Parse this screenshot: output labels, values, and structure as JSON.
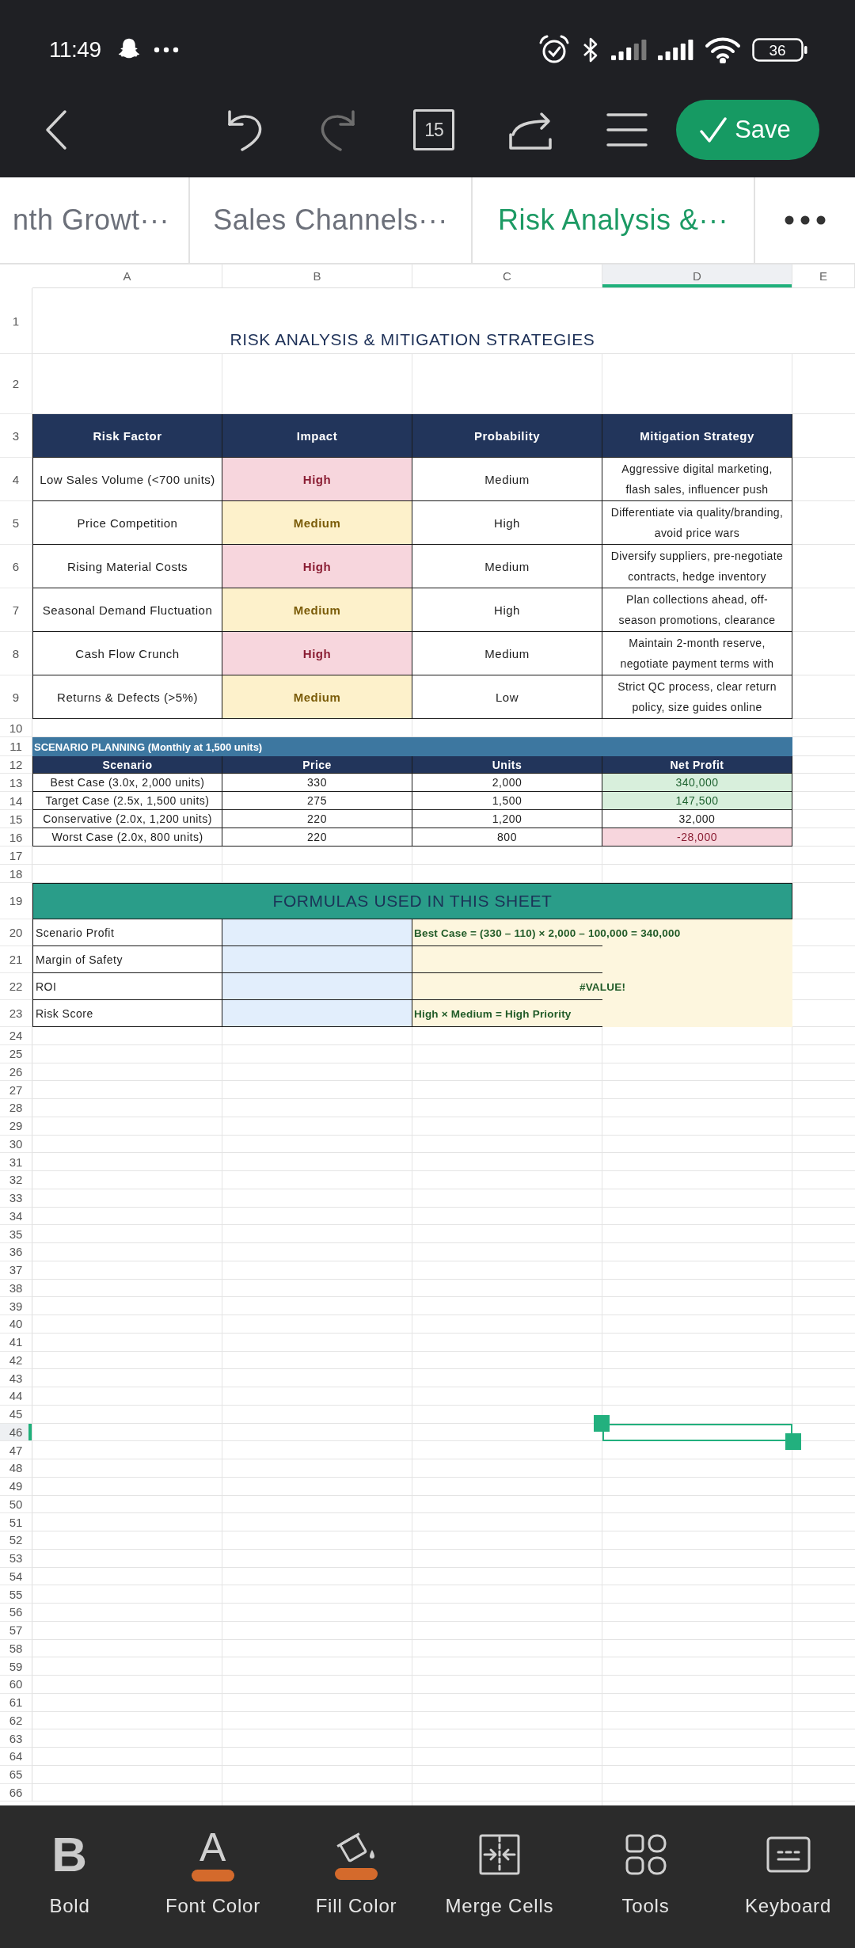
{
  "status_bar": {
    "time": "11:49",
    "battery": "36"
  },
  "toolbar": {
    "sheet_count": "15",
    "redo_disabled": true,
    "save_label": "Save"
  },
  "sheet_tabs": [
    {
      "label": "nth Growt···",
      "selected": false
    },
    {
      "label": "Sales Channels···",
      "selected": false
    },
    {
      "label": "Risk Analysis &···",
      "selected": true
    }
  ],
  "columns": [
    {
      "label": "A",
      "selected": false
    },
    {
      "label": "B",
      "selected": false
    },
    {
      "label": "C",
      "selected": false
    },
    {
      "label": "D",
      "selected": true
    },
    {
      "label": "E",
      "selected": false
    }
  ],
  "row_numbers": [
    {
      "label": "1",
      "selected": false
    },
    {
      "label": "2",
      "selected": false
    },
    {
      "label": "3",
      "selected": false
    },
    {
      "label": "4",
      "selected": false
    },
    {
      "label": "5",
      "selected": false
    },
    {
      "label": "6",
      "selected": false
    },
    {
      "label": "7",
      "selected": false
    },
    {
      "label": "8",
      "selected": false
    },
    {
      "label": "9",
      "selected": false
    },
    {
      "label": "10",
      "selected": false
    },
    {
      "label": "11",
      "selected": false
    },
    {
      "label": "12",
      "selected": false
    },
    {
      "label": "13",
      "selected": false
    },
    {
      "label": "14",
      "selected": false
    },
    {
      "label": "15",
      "selected": false
    },
    {
      "label": "16",
      "selected": false
    },
    {
      "label": "17",
      "selected": false
    },
    {
      "label": "18",
      "selected": false
    },
    {
      "label": "19",
      "selected": false
    },
    {
      "label": "20",
      "selected": false
    },
    {
      "label": "21",
      "selected": false
    },
    {
      "label": "22",
      "selected": false
    },
    {
      "label": "23",
      "selected": false
    },
    {
      "label": "24",
      "selected": false
    },
    {
      "label": "25",
      "selected": false
    },
    {
      "label": "26",
      "selected": false
    },
    {
      "label": "27",
      "selected": false
    },
    {
      "label": "28",
      "selected": false
    },
    {
      "label": "29",
      "selected": false
    },
    {
      "label": "30",
      "selected": false
    },
    {
      "label": "31",
      "selected": false
    },
    {
      "label": "32",
      "selected": false
    },
    {
      "label": "33",
      "selected": false
    },
    {
      "label": "34",
      "selected": false
    },
    {
      "label": "35",
      "selected": false
    },
    {
      "label": "36",
      "selected": false
    },
    {
      "label": "37",
      "selected": false
    },
    {
      "label": "38",
      "selected": false
    },
    {
      "label": "39",
      "selected": false
    },
    {
      "label": "40",
      "selected": false
    },
    {
      "label": "41",
      "selected": false
    },
    {
      "label": "42",
      "selected": false
    },
    {
      "label": "43",
      "selected": false
    },
    {
      "label": "44",
      "selected": false
    },
    {
      "label": "45",
      "selected": false
    },
    {
      "label": "46",
      "selected": true
    },
    {
      "label": "47",
      "selected": false
    },
    {
      "label": "48",
      "selected": false
    },
    {
      "label": "49",
      "selected": false
    },
    {
      "label": "50",
      "selected": false
    },
    {
      "label": "51",
      "selected": false
    },
    {
      "label": "52",
      "selected": false
    },
    {
      "label": "53",
      "selected": false
    },
    {
      "label": "54",
      "selected": false
    },
    {
      "label": "55",
      "selected": false
    },
    {
      "label": "56",
      "selected": false
    },
    {
      "label": "57",
      "selected": false
    },
    {
      "label": "58",
      "selected": false
    },
    {
      "label": "59",
      "selected": false
    },
    {
      "label": "60",
      "selected": false
    },
    {
      "label": "61",
      "selected": false
    },
    {
      "label": "62",
      "selected": false
    },
    {
      "label": "63",
      "selected": false
    },
    {
      "label": "64",
      "selected": false
    },
    {
      "label": "65",
      "selected": false
    },
    {
      "label": "66",
      "selected": false
    }
  ],
  "title": "RISK ANALYSIS & MITIGATION STRATEGIES",
  "risk_table": {
    "columns": [
      "Risk Factor",
      "Impact",
      "Probability",
      "Mitigation Strategy"
    ],
    "rows": [
      {
        "factor": "Low Sales Volume (<700 units)",
        "impact": "High",
        "kind": "high",
        "probability": "Medium",
        "strategy": [
          "Aggressive digital marketing,",
          "flash sales, influencer push"
        ]
      },
      {
        "factor": "Price Competition",
        "impact": "Medium",
        "kind": "medium",
        "probability": "High",
        "strategy": [
          "Differentiate via quality/branding,",
          "avoid price wars"
        ]
      },
      {
        "factor": "Rising Material Costs",
        "impact": "High",
        "kind": "high",
        "probability": "Medium",
        "strategy": [
          "Diversify suppliers, pre-negotiate",
          "contracts, hedge inventory"
        ]
      },
      {
        "factor": "Seasonal Demand Fluctuation",
        "impact": "Medium",
        "kind": "medium",
        "probability": "High",
        "strategy": [
          "Plan collections ahead, off-",
          "season promotions, clearance"
        ]
      },
      {
        "factor": "Cash Flow Crunch",
        "impact": "High",
        "kind": "high",
        "probability": "Medium",
        "strategy": [
          "Maintain 2-month reserve,",
          "negotiate payment terms with"
        ]
      },
      {
        "factor": "Returns & Defects (>5%)",
        "impact": "Medium",
        "kind": "medium",
        "probability": "Low",
        "strategy": [
          "Strict QC process, clear return",
          "policy, size guides online"
        ]
      }
    ]
  },
  "scenario_table": {
    "heading": "SCENARIO PLANNING (Monthly at 1,500 units)",
    "columns": [
      "Scenario",
      "Price",
      "Units",
      "Net Profit"
    ],
    "rows": [
      {
        "scenario": "Best Case (3.0x, 2,000 units)",
        "price": "330",
        "units": "2,000",
        "net_profit": "340,000",
        "kind": "gain"
      },
      {
        "scenario": "Target Case (2.5x, 1,500 units)",
        "price": "275",
        "units": "1,500",
        "net_profit": "147,500",
        "kind": "gain"
      },
      {
        "scenario": "Conservative (2.0x, 1,200 units)",
        "price": "220",
        "units": "1,200",
        "net_profit": "32,000",
        "kind": "neutral"
      },
      {
        "scenario": "Worst Case (2.0x, 800 units)",
        "price": "220",
        "units": "800",
        "net_profit": "-28,000",
        "kind": "loss"
      }
    ]
  },
  "formulas": {
    "heading": "FORMULAS USED IN THIS SHEET",
    "rows": [
      {
        "label": "Scenario Profit",
        "result": "Best Case = (330 – 110) × 2,000 – 100,000 = 340,000",
        "kind": "formula"
      },
      {
        "label": "Margin of Safety",
        "kind": "formula"
      },
      {
        "label": "ROI",
        "result": "#VALUE!",
        "kind": "error"
      },
      {
        "label": "Risk Score",
        "result": "High × Medium = High Priority",
        "kind": "formula"
      }
    ]
  },
  "bottom_toolbar": {
    "format_tools": [
      {
        "label": "Bold",
        "kind": "bold",
        "glyph": "B"
      },
      {
        "label": "Font Color",
        "kind": "font-color",
        "glyph": "A",
        "color": "#d46a2c"
      },
      {
        "label": "Fill Color",
        "kind": "fill-color",
        "color": "#d46a2c"
      },
      {
        "label": "Merge Cells",
        "kind": "merge"
      }
    ],
    "app_tools": [
      {
        "label": "Tools",
        "kind": "tools"
      },
      {
        "label": "Keyboard",
        "kind": "keyboard"
      }
    ]
  }
}
